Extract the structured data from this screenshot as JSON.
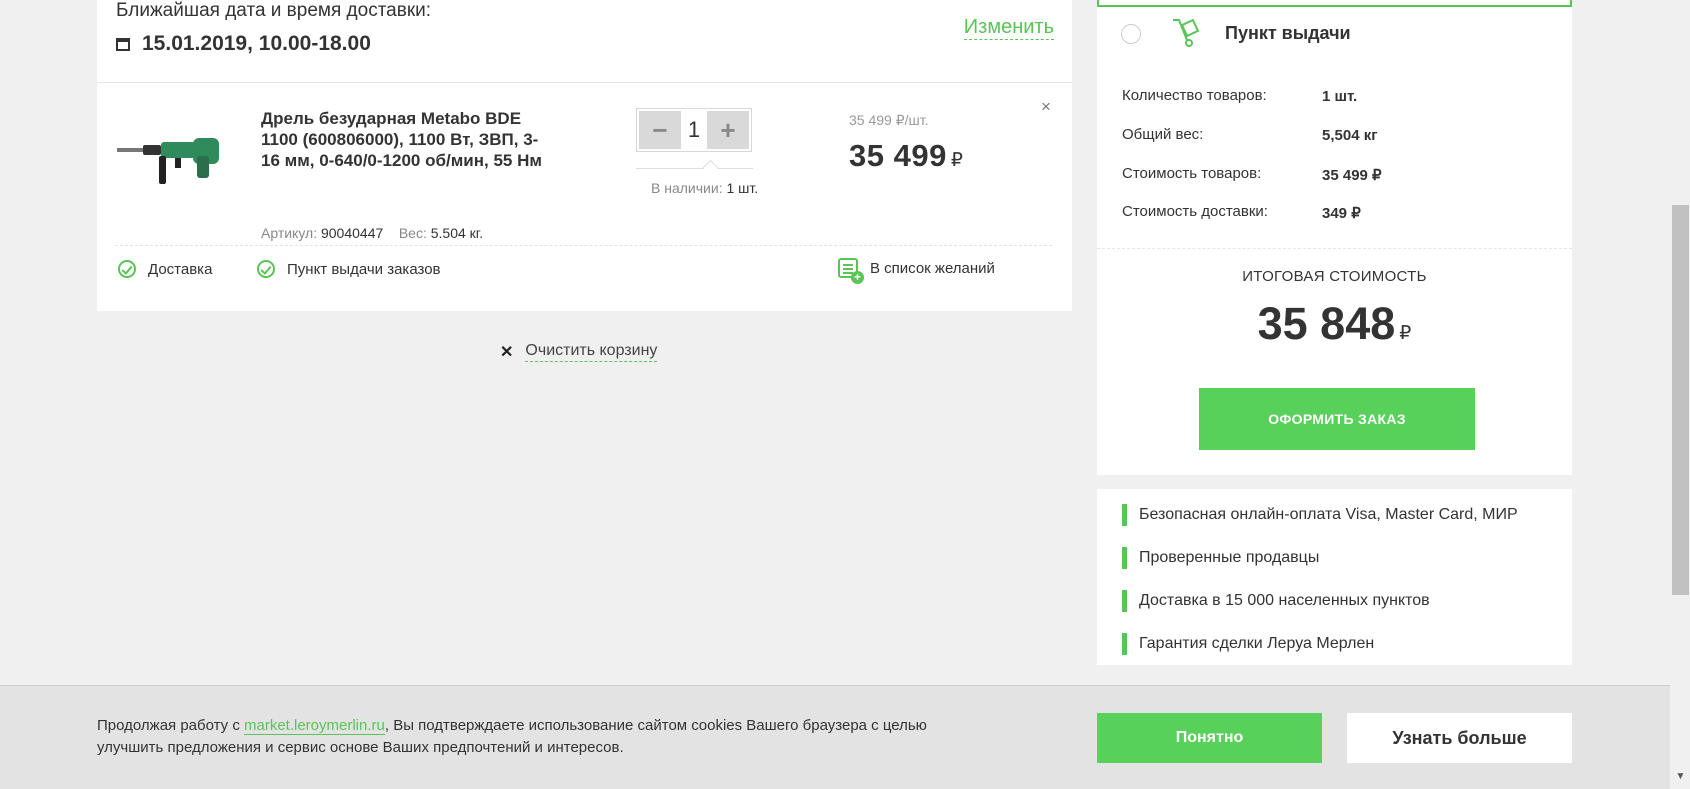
{
  "delivery": {
    "label": "Ближайшая дата и время доставки:",
    "date": "15.01.2019, 10.00-18.00",
    "change_link": "Изменить"
  },
  "product": {
    "title": "Дрель безударная Metabo BDE 1100 (600806000), 1100 Вт, ЗВП, 3-16 мм, 0-640/0-1200 об/мин, 55 Нм",
    "article_label": "Артикул:",
    "article_value": "90040447",
    "weight_label": "Вес:",
    "weight_value": "5.504 кг.",
    "quantity": "1",
    "qty_minus": "−",
    "qty_plus": "+",
    "stock_label": "В наличии:",
    "stock_value": "1 шт.",
    "unit_price": "35 499 ₽/шт.",
    "price": "35 499",
    "currency": "₽",
    "remove": "×"
  },
  "options": {
    "delivery": "Доставка",
    "pickup": "Пункт выдачи заказов",
    "wishlist": "В список желаний"
  },
  "clear_cart": {
    "icon": "✕",
    "label": "Очистить корзину"
  },
  "summary": {
    "pickup_title": "Пункт выдачи",
    "rows": [
      {
        "label": "Количество товаров:",
        "value": "1 шт."
      },
      {
        "label": "Общий вес:",
        "value": "5,504 кг"
      },
      {
        "label": "Стоимость товаров:",
        "value": "35 499 ₽"
      },
      {
        "label": "Стоимость доставки:",
        "value": "349 ₽"
      }
    ],
    "total_label": "ИТОГОВАЯ СТОИМОСТЬ",
    "total_value": "35 848",
    "currency": "₽",
    "order_button": "ОФОРМИТЬ ЗАКАЗ"
  },
  "features": [
    "Безопасная онлайн-оплата Visa, Master Card, МИР",
    "Проверенные продавцы",
    "Доставка в 15 000 населенных пунктов",
    "Гарантия сделки Леруа Мерлен"
  ],
  "cookie": {
    "text_before": "Продолжая работу с ",
    "link": "market.leroymerlin.ru",
    "text_after": ", Вы подтверждаете использование сайтом cookies Вашего браузера с целью улучшить предложения и сервис  основе Ваших предпочтений и интересов.",
    "ok_button": "Понятно",
    "more_button": "Узнать больше"
  },
  "icons": {
    "calendar": "calendar-icon",
    "check": "check-circle-icon",
    "wishlist": "wishlist-add-icon",
    "cart": "hand-truck-icon",
    "close": "close-icon",
    "scroll_down": "scroll-down-arrow-icon"
  },
  "colors": {
    "accent": "#58c556",
    "button": "#58d15a",
    "background": "#f0f0f0"
  },
  "scroll_arrow": "▼"
}
